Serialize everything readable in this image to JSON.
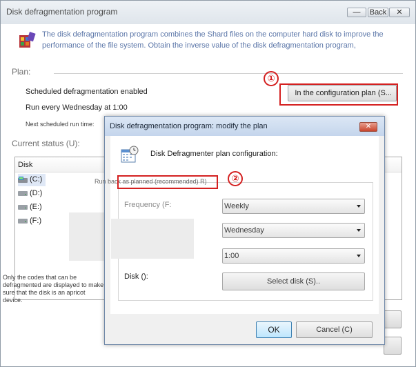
{
  "main_window": {
    "title": "Disk defragmentation program",
    "caption_buttons": {
      "minimize": "—",
      "back": "Back",
      "close": "✕"
    },
    "description": "The disk defragmentation program combines the Shard files on the computer hard disk to improve the performance of the file system. Obtain the inverse value of the disk defragmentation program,",
    "plan": {
      "label": "Plan:",
      "scheduled_text": "Scheduled defragmentation enabled",
      "run_every": "Run every Wednesday at 1:00",
      "next_run": "Next scheduled run time:",
      "config_button": "In the configuration plan (S..."
    },
    "status": {
      "label": "Current status (U):",
      "column_disk": "Disk",
      "disks": [
        "(C:)",
        "(D:)",
        "(E:)",
        "(F:)"
      ]
    },
    "codes_note": "Only the codes that can be defragmented are displayed to make sure that the disk is an apricot device."
  },
  "annotations": {
    "marker_1": "①",
    "marker_2": "②"
  },
  "dialog": {
    "title": "Disk defragmentation program: modify the plan",
    "close_glyph": "✕",
    "heading": "Disk Defragmenter plan configuration:",
    "run_backlog": "Run back as planned (recommended) R)",
    "frequency_label": "Frequency (F:",
    "frequency_value": "Weekly",
    "day_value": "Wednesday",
    "time_value": "1:00",
    "disk_label": "Disk ():",
    "select_disk_button": "Select disk (S)..",
    "ok_button": "OK",
    "cancel_button": "Cancel (C)"
  },
  "colors": {
    "annotation_red": "#d42020",
    "description_blue": "#5b76a8"
  }
}
